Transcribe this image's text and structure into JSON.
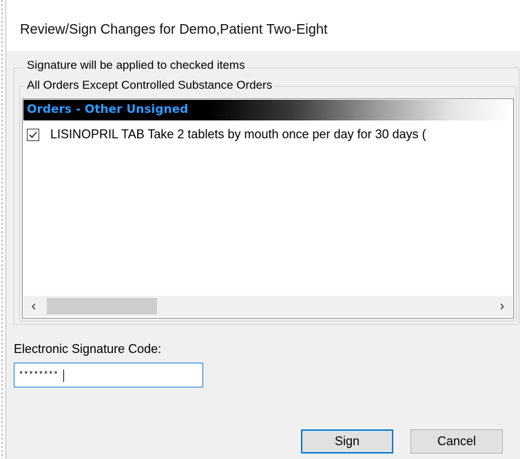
{
  "window": {
    "title": "Review/Sign Changes for Demo,Patient Two-Eight"
  },
  "signature_group": {
    "label": "Signature will be applied to checked items"
  },
  "orders_group": {
    "label": "All Orders Except Controlled Substance Orders",
    "list_header": "Orders - Other Unsigned",
    "items": [
      {
        "checked": true,
        "text": "LISINOPRIL TAB  Take 2 tablets by mouth once per day for 30 days  ("
      }
    ],
    "scrollbar": {
      "left_arrow": "‹",
      "right_arrow": "›"
    }
  },
  "esig": {
    "label": "Electronic Signature Code:",
    "value": "********"
  },
  "buttons": {
    "sign": "Sign",
    "cancel": "Cancel"
  },
  "colors": {
    "list_header_text": "#3399ff",
    "focus_border": "#0078d7"
  }
}
